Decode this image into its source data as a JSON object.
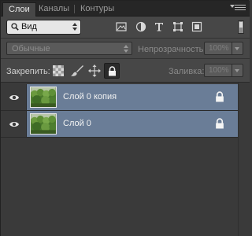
{
  "tabs": [
    {
      "label": "Слои",
      "active": true
    },
    {
      "label": "Каналы",
      "active": false
    },
    {
      "label": "Контуры",
      "active": false
    }
  ],
  "filter": {
    "kind_label": "Вид",
    "icons": [
      "image-filter-icon",
      "adjustment-filter-icon",
      "type-filter-icon",
      "shape-filter-icon",
      "smart-object-filter-icon"
    ]
  },
  "blend": {
    "mode": "Обычные",
    "opacity_label": "Непрозрачность:",
    "opacity_value": "100%"
  },
  "lock": {
    "label": "Закрепить:",
    "fill_label": "Заливка:",
    "fill_value": "100%"
  },
  "layers": [
    {
      "name": "Слой 0 копия",
      "visible": true,
      "locked": true
    },
    {
      "name": "Слой 0",
      "visible": true,
      "locked": true
    }
  ],
  "colors": {
    "panel_bg": "#474747",
    "selected_layer": "#6a7d97",
    "tab_bar": "#262626"
  }
}
